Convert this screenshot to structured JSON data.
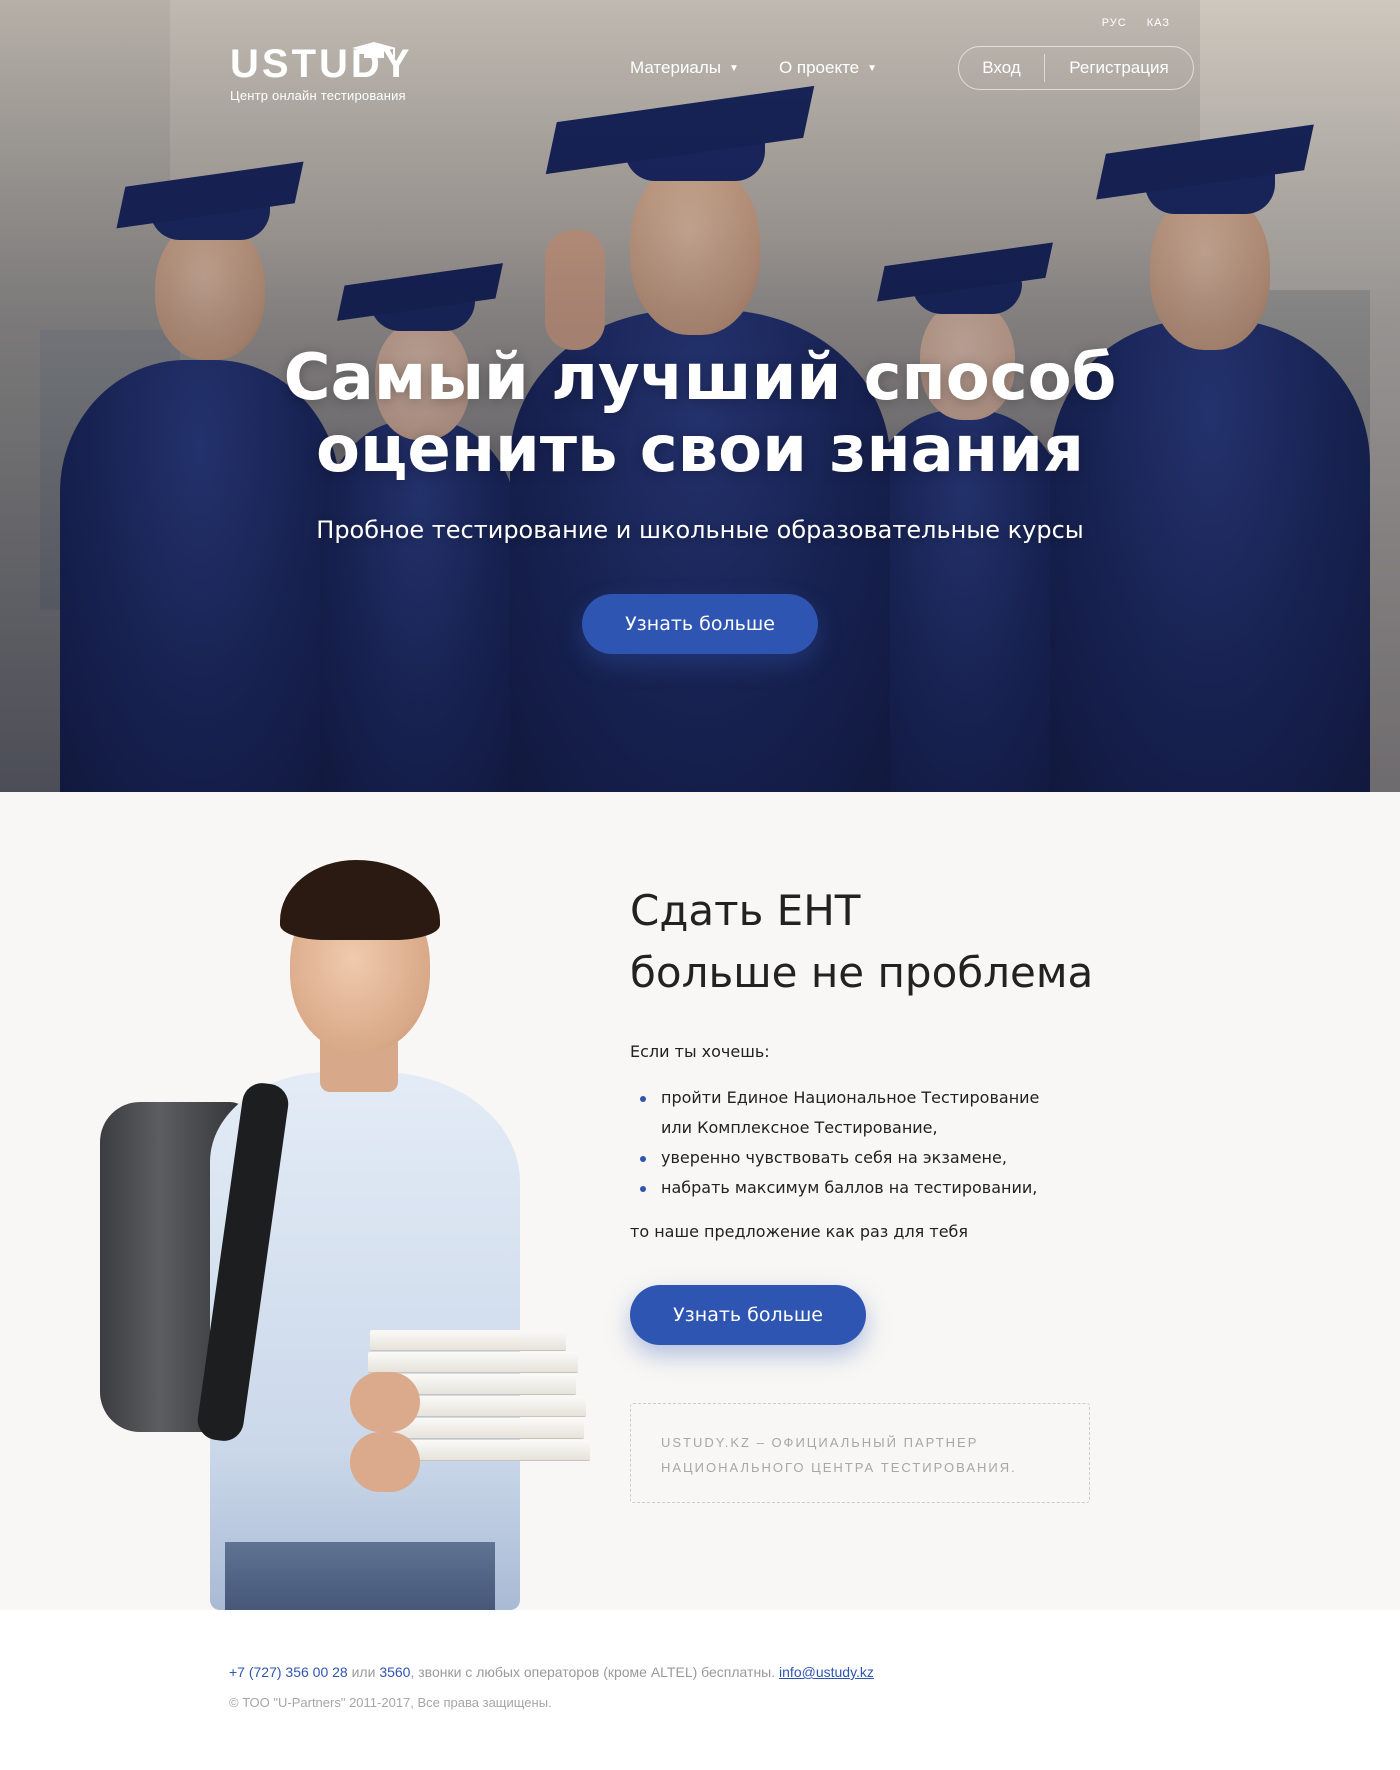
{
  "header": {
    "logo_text": "USTUDY",
    "logo_sub": "Центр онлайн тестирования",
    "languages": [
      "РУС",
      "КАЗ"
    ],
    "nav": [
      {
        "label": "Материалы"
      },
      {
        "label": "О проекте"
      }
    ],
    "login_label": "Вход",
    "register_label": "Регистрация"
  },
  "hero": {
    "title_line1": "Самый лучший способ",
    "title_line2": "оценить свои знания",
    "subtitle": "Пробное тестирование и школьные образовательные курсы",
    "cta_label": "Узнать больше"
  },
  "about": {
    "title_line1": "Сдать ЕНТ",
    "title_line2": "больше не проблема",
    "intro": "Если ты хочешь:",
    "bullets": [
      "пройти Единое Национальное Тестирование",
      "или Комплексное Тестирование,",
      "уверенно чувствовать себя на экзамене,",
      "набрать максимум баллов на тестировании,"
    ],
    "outro": "то наше предложение как раз для тебя",
    "cta_label": "Узнать больше",
    "partner_line1": "USTUDY.KZ – официальный партнер",
    "partner_line2": "национального центра тестирования."
  },
  "footer": {
    "phone1": "+7 (727) 356 00 28",
    "or": " или ",
    "phone2": "3560",
    "calls_note": ", звонки с любых операторов (кроме ALTEL) бесплатны. ",
    "email": "info@ustudy.kz",
    "copyright": "© ТОО \"U-Partners\" 2011-2017, Все права защищены."
  },
  "colors": {
    "accent": "#2f55b3",
    "gown": "#1d2a63",
    "section_bg": "#f8f7f5"
  },
  "icons": {
    "logo_cap": "graduation-cap-icon",
    "dropdown": "caret-down-icon"
  }
}
